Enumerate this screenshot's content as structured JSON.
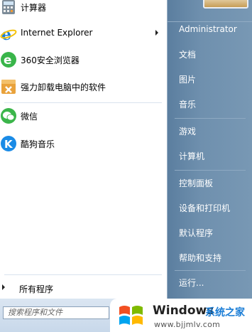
{
  "programs": [
    {
      "label": "计算器",
      "icon": "calculator-icon"
    },
    {
      "label": "Internet Explorer",
      "icon": "ie-icon",
      "has_submenu": true
    },
    {
      "label": "360安全浏览器",
      "icon": "browser-360-icon"
    },
    {
      "label": "强力卸载电脑中的软件",
      "icon": "uninstall-box-icon"
    },
    {
      "label": "微信",
      "icon": "wechat-icon"
    },
    {
      "label": "酷狗音乐",
      "icon": "kugou-icon"
    }
  ],
  "all_programs_label": "所有程序",
  "search": {
    "placeholder": "搜索程序和文件"
  },
  "right_menu": {
    "user_name": "Administrator",
    "items": [
      "文档",
      "图片",
      "音乐",
      "游戏",
      "计算机",
      "控制面板",
      "设备和打印机",
      "默认程序",
      "帮助和支持",
      "运行..."
    ]
  },
  "watermark": {
    "brand": "Windows",
    "tagline": "系统之家",
    "url": "www.bjjmlv.com"
  },
  "colors": {
    "accent_blue": "#1a7dd6",
    "right_panel": "#6f90ae"
  }
}
